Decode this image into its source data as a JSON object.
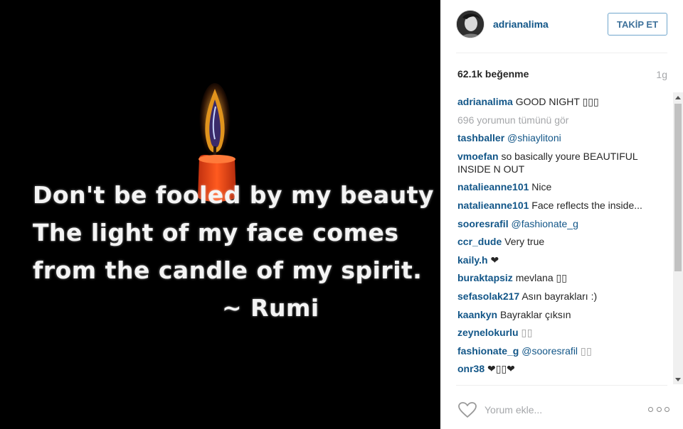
{
  "post": {
    "quote_lines": [
      "Don't be fooled by my beauty",
      "The light of my face comes",
      "from the candle of my spirit."
    ],
    "quote_author": "~ Rumi"
  },
  "header": {
    "username": "adrianalima",
    "follow_label": "TAKİP ET"
  },
  "stats": {
    "likes": "62.1k beğenme",
    "time_ago": "1g"
  },
  "caption": {
    "username": "adrianalima",
    "text": "GOOD NIGHT ▯▯▯"
  },
  "view_all_comments": "696 yorumun tümünü gör",
  "comments": [
    {
      "username": "tashballer",
      "mention": "@shiaylitoni",
      "text": ""
    },
    {
      "username": "vmoefan",
      "mention": "",
      "text": "so basically youre BEAUTIFUL INSIDE N OUT"
    },
    {
      "username": "natalieanne101",
      "mention": "",
      "text": "Nice"
    },
    {
      "username": "natalieanne101",
      "mention": "",
      "text": "Face reflects the inside..."
    },
    {
      "username": "sooresrafil",
      "mention": "@fashionate_g",
      "text": ""
    },
    {
      "username": "ccr_dude",
      "mention": "",
      "text": "Very true"
    },
    {
      "username": "kaily.h",
      "mention": "",
      "text": "❤"
    },
    {
      "username": "buraktapsiz",
      "mention": "",
      "text": "mevlana ▯▯"
    },
    {
      "username": "sefasolak217",
      "mention": "",
      "text": "Asın bayrakları :)"
    },
    {
      "username": "kaankyn",
      "mention": "",
      "text": "Bayraklar çıksın"
    },
    {
      "username": "zeynelokurlu",
      "mention": "",
      "text": "▯▯"
    },
    {
      "username": "fashionate_g",
      "mention": "@sooresrafil",
      "text": "▯▯"
    },
    {
      "username": "onr38",
      "mention": "",
      "text": "❤▯▯❤"
    }
  ],
  "footer": {
    "comment_placeholder": "Yorum ekle..."
  },
  "colors": {
    "link_blue": "#125688",
    "follow_blue": "#3f729b",
    "muted_gray": "#a5a7aa"
  }
}
